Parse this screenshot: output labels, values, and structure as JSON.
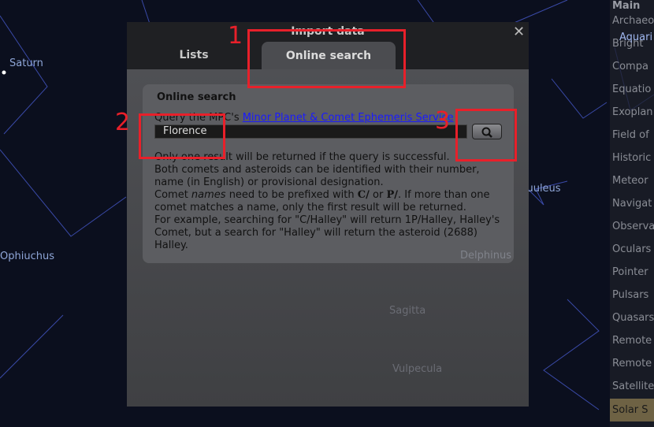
{
  "sky_labels": {
    "saturn": "Saturn",
    "ophiuchus": "Ophiuchus",
    "equuleus": "Equuleus",
    "delphinus": "Delphinus",
    "sagitta": "Sagitta",
    "vulpecula": "Vulpecula",
    "aquarius": "Aquari"
  },
  "right_panel": {
    "header": "Main",
    "items": [
      "Archaeo",
      "Bright",
      "Compa",
      "Equatio",
      "Exoplan",
      "Field of",
      "Historic",
      "Meteor",
      "Navigat",
      "Observa",
      "Oculars",
      "Pointer",
      "Pulsars",
      "Quasars",
      "Remote",
      "Remote",
      "Satellite",
      "Solar S"
    ],
    "selected_index": 17
  },
  "dialog": {
    "title": "Import data",
    "close": "✕",
    "tabs": [
      {
        "label": "Lists"
      },
      {
        "label": "Online search",
        "active": true
      }
    ],
    "group_title": "Online search",
    "query_prefix": "Query the MPC's ",
    "query_link": "Minor Planet & Comet Ephemeris Service",
    "input_value": "Florence",
    "search_icon": "magnifier-icon",
    "help": {
      "l1": "Only one result will be returned if the query is successful.",
      "l2": "Both comets and asteroids can be identified with their number, name (in English) or provisional designation.",
      "l3a": "Comet ",
      "l3b": "names",
      "l3c": " need to be prefixed with ",
      "c": "C/",
      "or": " or ",
      "p": "P/",
      "l3d": ". If more than one comet matches a name, only the first result will be returned.",
      "l4": "For example, searching for \"C/Halley\" will return 1P/Halley, Halley's Comet, but a search for \"Halley\" will return the asteroid (2688) Halley."
    }
  },
  "annotations": [
    "1",
    "2",
    "3"
  ],
  "colors": {
    "annotation": "#e8202a",
    "link": "#1a1aff",
    "selected_item": "#6e6244"
  }
}
